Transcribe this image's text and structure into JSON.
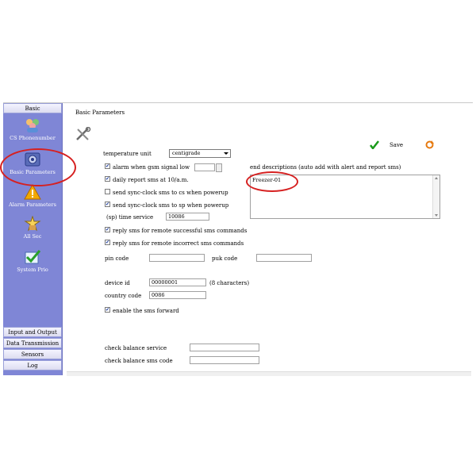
{
  "sidebar": {
    "header": "Basic",
    "items": [
      {
        "label": "CS Phonenumber",
        "icon": "users-icon"
      },
      {
        "label": "Basic Parameters",
        "icon": "settings-icon"
      },
      {
        "label": "Alarm Parameters",
        "icon": "warning-icon"
      },
      {
        "label": "All Sec",
        "icon": "security-icon"
      },
      {
        "label": "System Prio",
        "icon": "check-icon"
      }
    ],
    "bottom_tabs": [
      "Input and Output",
      "Data Transmission",
      "Sensors",
      "Log"
    ]
  },
  "group_title": "Basic Parameters",
  "toolbar": {
    "save_label": "Save"
  },
  "form": {
    "temperature_unit_label": "temperature unit",
    "temperature_unit_value": "centigrade",
    "alarm_gsm_label": "alarm when gsm signal low",
    "alarm_gsm_checked": true,
    "alarm_gsm_value": "",
    "daily_report_label": "daily report sms at 10/a.m.",
    "daily_report_checked": true,
    "sync_cs_label": "send sync-clock sms to cs when powerup",
    "sync_cs_checked": false,
    "sync_sp_label": "send sync-clock sms to sp when powerup",
    "sync_sp_checked": true,
    "time_service_label": "(sp) time service",
    "time_service_value": "10086",
    "reply_success_label": "reply sms for remote successful sms commands",
    "reply_success_checked": true,
    "reply_incorrect_label": "reply sms for remote incorrect sms commands",
    "reply_incorrect_checked": true,
    "pin_label": "pin code",
    "pin_value": "",
    "puk_label": "puk code",
    "puk_value": "",
    "device_id_label": "device id",
    "device_id_value": "00000001",
    "device_id_hint": "(8 characters)",
    "country_code_label": "country code",
    "country_code_value": "0086",
    "sms_forward_label": "enable the sms forward",
    "sms_forward_checked": true,
    "check_balance_service_label": "check balance service",
    "check_balance_service_value": "",
    "check_balance_sms_label": "check balance sms code",
    "check_balance_sms_value": "",
    "descriptions_label": "end descriptions (auto add with alert and report sms)",
    "descriptions_value": "Freezer-01"
  },
  "colors": {
    "sidebar": "#7f86d6",
    "highlight_oval": "#d62020"
  }
}
